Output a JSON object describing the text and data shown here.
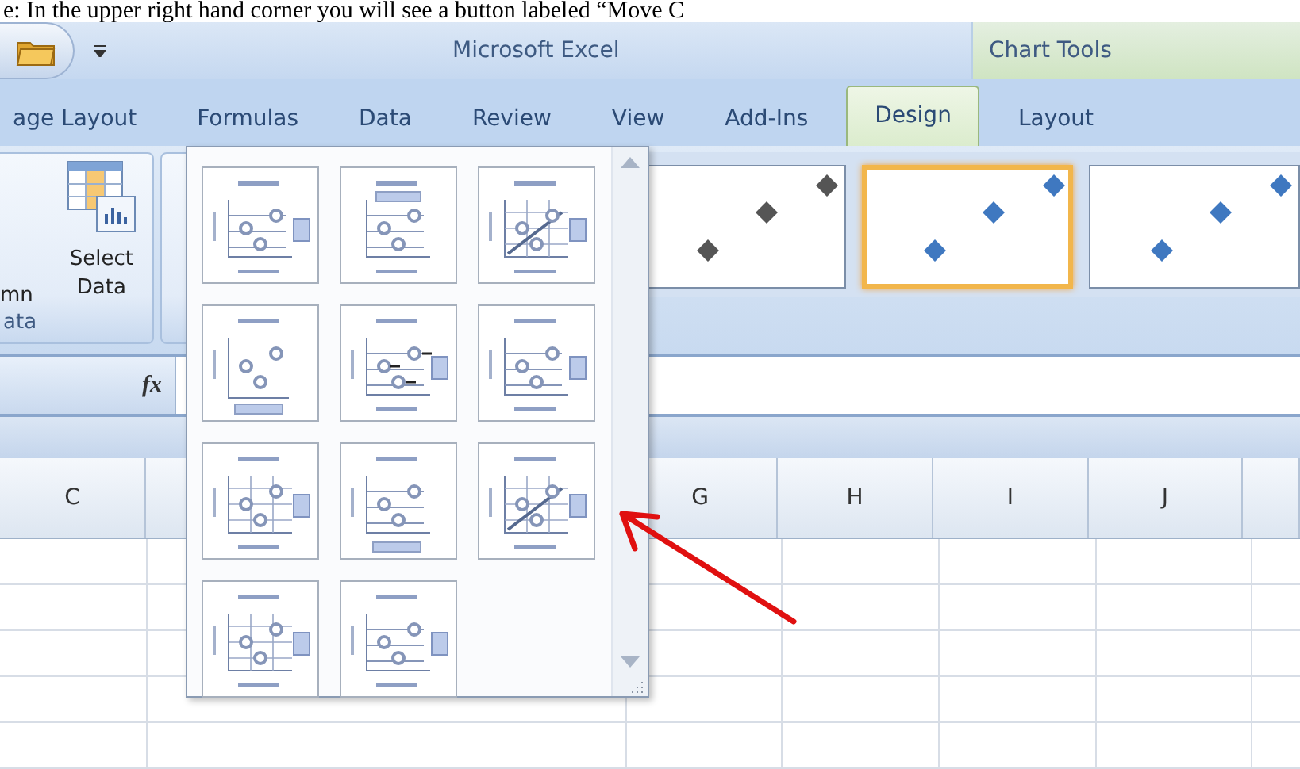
{
  "document_text": "e: In the upper right hand corner you will see a button labeled “Move C",
  "title_bar": {
    "title": "Microsoft Excel",
    "context_title": "Chart Tools"
  },
  "tabs": [
    {
      "label": "age Layout",
      "selected": false
    },
    {
      "label": "Formulas",
      "selected": false
    },
    {
      "label": "Data",
      "selected": false
    },
    {
      "label": "Review",
      "selected": false
    },
    {
      "label": "View",
      "selected": false
    },
    {
      "label": "Add-Ins",
      "selected": false
    },
    {
      "label": "Design",
      "selected": true
    },
    {
      "label": "Layout",
      "selected": false
    }
  ],
  "ribbon": {
    "cut_button_label": "mn",
    "select_data_label": "Select Data",
    "group_label": "ata"
  },
  "chart_styles": [
    {
      "selected": false,
      "color": "#555555"
    },
    {
      "selected": true,
      "color": "#3f78c0"
    },
    {
      "selected": false,
      "color": "#3f78c0"
    }
  ],
  "formula_bar": {
    "function_label": "fx"
  },
  "columns": [
    {
      "label": "C"
    },
    {
      "label": "G"
    },
    {
      "label": "H"
    },
    {
      "label": "I"
    },
    {
      "label": "J"
    }
  ],
  "layout_gallery": {
    "options": [
      {
        "kind": "legend"
      },
      {
        "kind": "top-legend"
      },
      {
        "kind": "trend"
      },
      {
        "kind": "plain"
      },
      {
        "kind": "labels"
      },
      {
        "kind": "legend"
      },
      {
        "kind": "grid"
      },
      {
        "kind": "bottom-legend"
      },
      {
        "kind": "trend"
      },
      {
        "kind": "grid"
      },
      {
        "kind": "plain-legend"
      }
    ]
  }
}
